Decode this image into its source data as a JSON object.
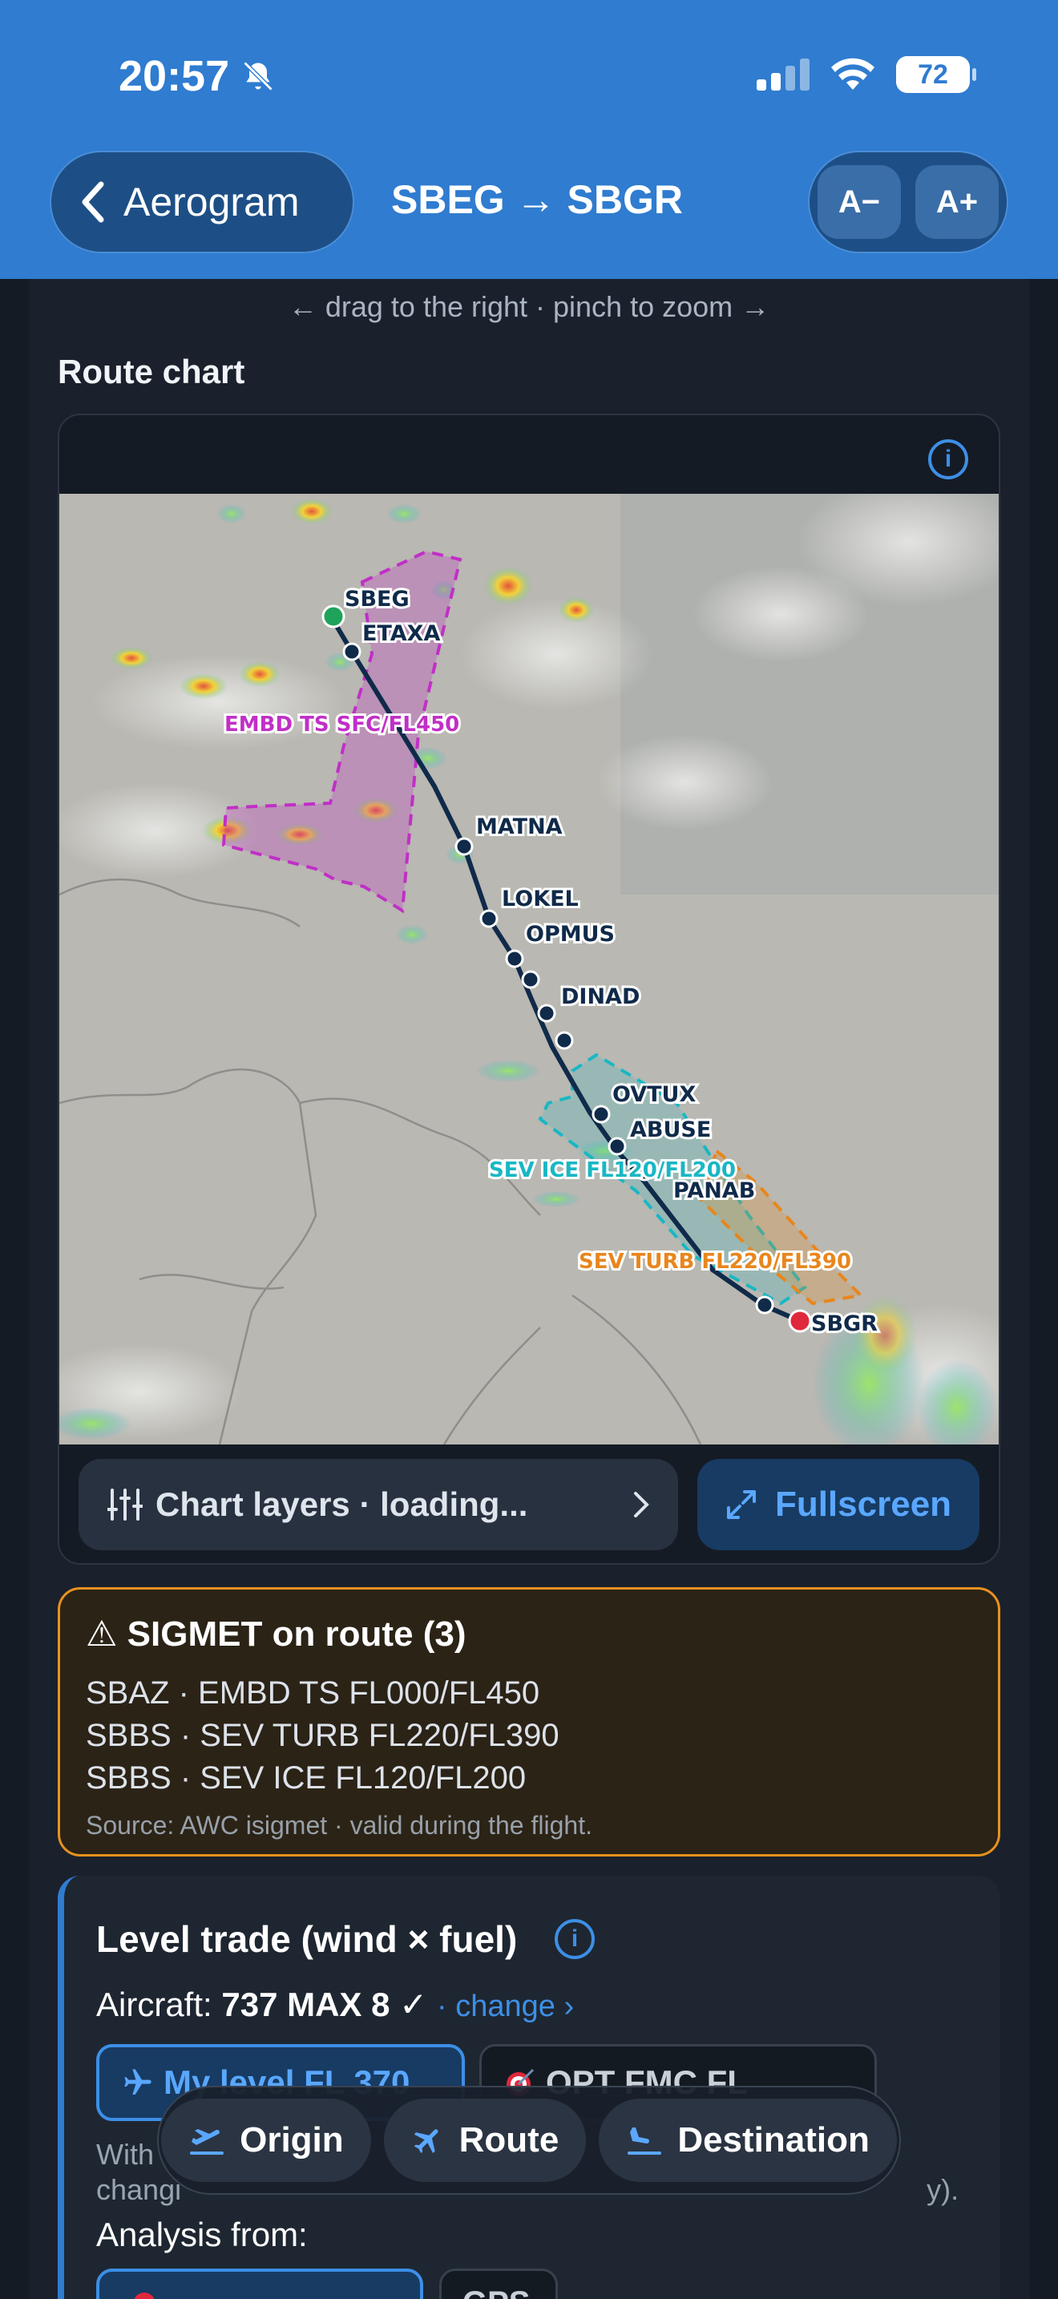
{
  "status_bar": {
    "time": "20:57",
    "battery": "72"
  },
  "header": {
    "back_label": "Aerogram",
    "title": "SBEG → SBGR",
    "font_decrease": "A−",
    "font_increase": "A+"
  },
  "hint": "← drag to the right · pinch to zoom →",
  "route_chart": {
    "title": "Route chart",
    "info": "i",
    "waypoints": [
      "SBEG",
      "ETAXA",
      "MATNA",
      "LOKEL",
      "OPMUS",
      "DINAD",
      "OVTUX",
      "ABUSE",
      "PANAB",
      "SBGR"
    ],
    "sigmet_labels": {
      "ts": "EMBD TS SFC/FL450",
      "ice": "SEV ICE FL120/FL200",
      "turb": "SEV TURB FL220/FL390"
    },
    "colors": {
      "route": "#102a4a",
      "origin": "#1fa35a",
      "destination": "#e0283c",
      "ts": "#c12fc7",
      "ice": "#19b7c4",
      "turb": "#e8861d"
    },
    "layers_button": "Chart layers · loading...",
    "fullscreen_button": "Fullscreen"
  },
  "sigmet": {
    "title": "⚠ SIGMET on route (3)",
    "lines": [
      "SBAZ · EMBD TS FL000/FL450",
      "SBBS · SEV TURB FL220/FL390",
      "SBBS · SEV ICE FL120/FL200"
    ],
    "source": "Source: AWC isigmet · valid during the flight."
  },
  "level_trade": {
    "title": "Level trade (wind × fuel)",
    "aircraft_label": "Aircraft: ",
    "aircraft_value": "737 MAX 8 ✓",
    "change_link": "· change ›",
    "my_level_button": "My level FL 370",
    "opt_button": "OPT FMC FL",
    "with_text_1": "With",
    "with_text_2": "changi",
    "with_text_3": "y).",
    "analysis_label": "Analysis from:",
    "gps_button": "GPS"
  },
  "bottom_nav": {
    "origin": "Origin",
    "route": "Route",
    "destination": "Destination"
  }
}
